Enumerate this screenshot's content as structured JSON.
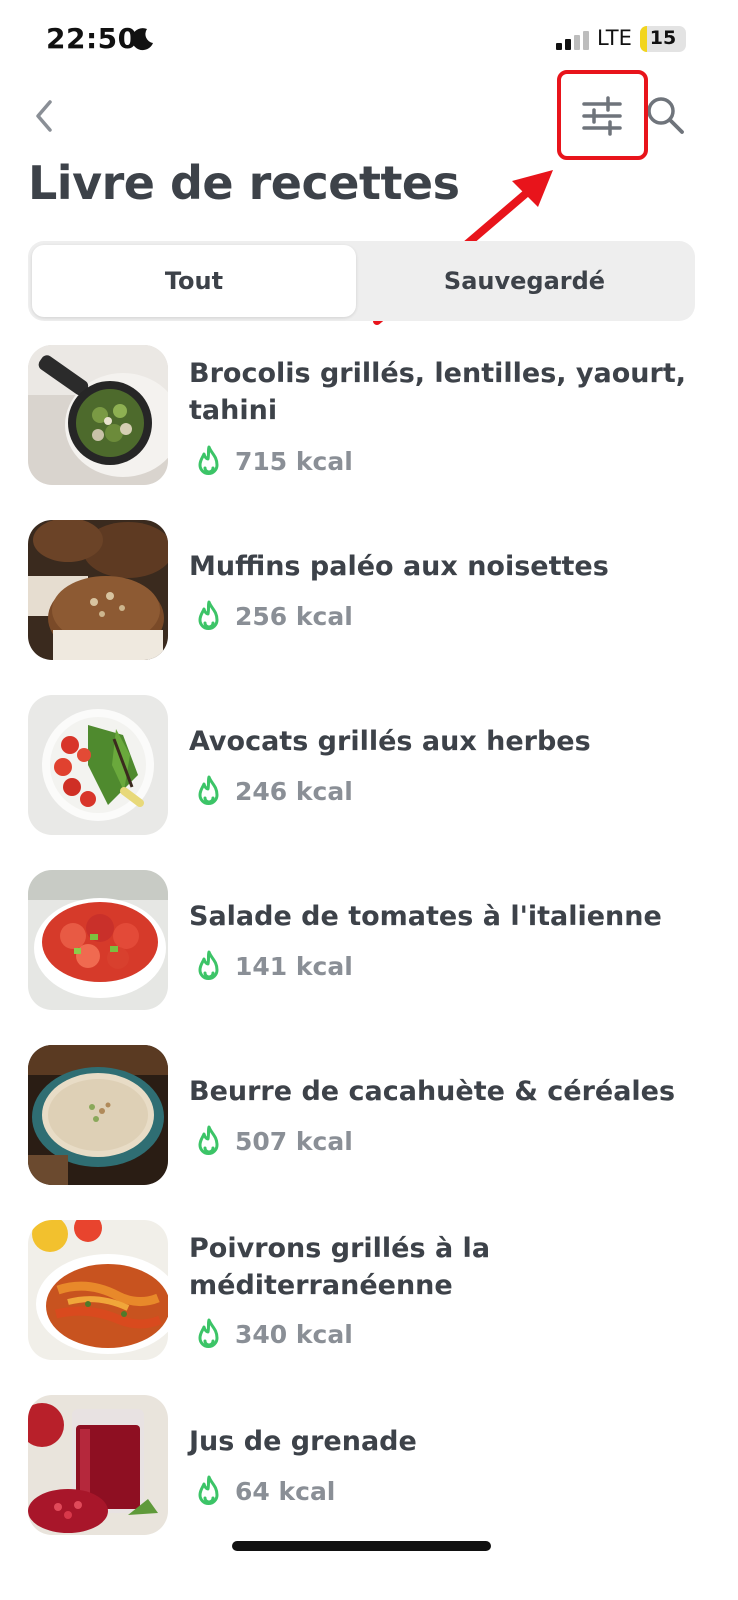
{
  "status_bar": {
    "time": "22:50",
    "network": "LTE",
    "battery_level": "15",
    "battery_fraction": 0.15,
    "battery_color": "#f2d51e"
  },
  "nav": {
    "back_icon": "chevron-left-icon",
    "filter_icon": "sliders-icon",
    "search_icon": "search-icon"
  },
  "page": {
    "title": "Livre de recettes"
  },
  "tabs": [
    {
      "label": "Tout",
      "active": true
    },
    {
      "label": "Sauvegardé",
      "active": false
    }
  ],
  "annotation": {
    "highlight_color": "#e8141b"
  },
  "recipes": [
    {
      "title": "Brocolis grillés, lentilles, yaourt, tahini",
      "kcal": "715 kcal",
      "image": "broccoli-skillet"
    },
    {
      "title": "Muffins paléo aux noisettes",
      "kcal": "256 kcal",
      "image": "muffins"
    },
    {
      "title": "Avocats grillés aux herbes",
      "kcal": "246 kcal",
      "image": "salad-plate"
    },
    {
      "title": "Salade de tomates à l'italienne",
      "kcal": "141 kcal",
      "image": "tomato-salad"
    },
    {
      "title": "Beurre de cacahuète & céréales",
      "kcal": "507 kcal",
      "image": "porridge-bowl"
    },
    {
      "title": "Poivrons grillés à la méditerranéenne",
      "kcal": "340 kcal",
      "image": "roasted-peppers"
    },
    {
      "title": "Jus de grenade",
      "kcal": "64 kcal",
      "image": "pomegranate-juice"
    }
  ],
  "colors": {
    "flame": "#3cc467",
    "text_primary": "#3d4249",
    "text_secondary": "#8a8f96"
  }
}
